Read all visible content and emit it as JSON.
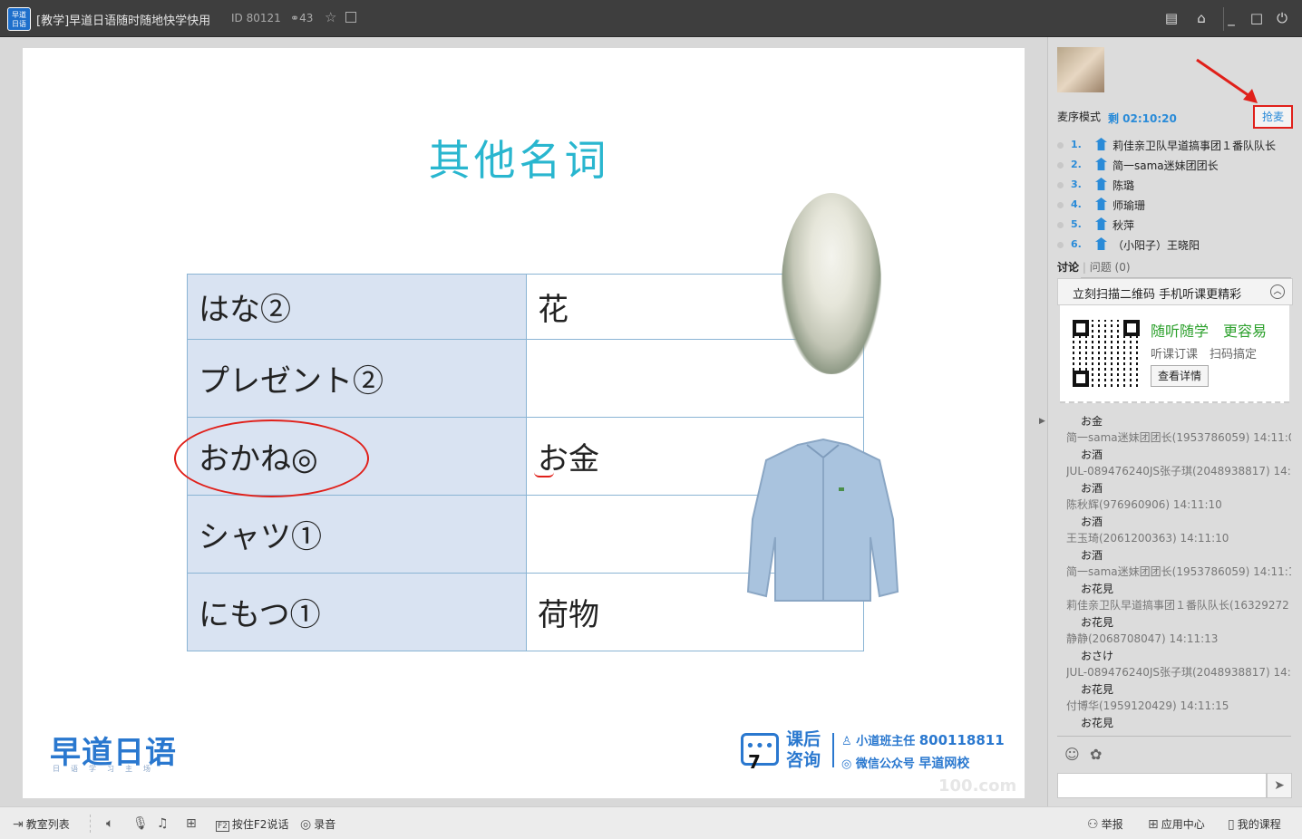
{
  "window": {
    "title": "[教学]早道日语随时随地快学快用",
    "room_id": "ID 80121",
    "user_count": "43",
    "logo_text": "早道日语"
  },
  "slide": {
    "title": "其他名词",
    "rows": [
      {
        "kana": "はな②",
        "kanji": "花"
      },
      {
        "kana": "プレゼント②",
        "kanji": ""
      },
      {
        "kana": "おかね◎",
        "kanji": "お金"
      },
      {
        "kana": "シャツ①",
        "kanji": ""
      },
      {
        "kana": "にもつ①",
        "kanji": "荷物"
      }
    ],
    "brand": "早道日语",
    "brand_sub": "日语学习主场",
    "consult": [
      "课后",
      "咨询"
    ],
    "contact1_label": "小道班主任",
    "contact1_value": "800118811",
    "contact2_label": "微信公众号",
    "contact2_value": "早道网校",
    "page_number": "7",
    "watermark": "100.com"
  },
  "panel": {
    "mode_label": "麦序模式",
    "time_left": "剩 02:10:20",
    "grab_mic": "抢麦",
    "queue": [
      {
        "num": "1.",
        "name": "莉佳亲卫队早道搞事团１番队队长"
      },
      {
        "num": "2.",
        "name": "简一sama迷妹团团长"
      },
      {
        "num": "3.",
        "name": "陈璐"
      },
      {
        "num": "4.",
        "name": "师瑜珊"
      },
      {
        "num": "5.",
        "name": "秋萍"
      },
      {
        "num": "6.",
        "name": "（小阳子）王晓阳"
      }
    ],
    "tab_discussion": "讨论",
    "tab_questions": "问题 (0)",
    "promo_header": "立刻扫描二维码 手机听课更精彩",
    "promo_line1": "随听随学　更容易",
    "promo_line2": "听课订课　扫码搞定",
    "promo_button": "查看详情",
    "chat": [
      {
        "text": "お金",
        "meta": "简一sama迷妹团团长(1953786059) 14:11:0"
      },
      {
        "text": "お酒",
        "meta": "JUL-089476240JS张子琪(2048938817) 14:"
      },
      {
        "text": "お酒",
        "meta": "陈秋辉(976960906) 14:11:10"
      },
      {
        "text": "お酒",
        "meta": "王玉琦(2061200363) 14:11:10"
      },
      {
        "text": "お酒",
        "meta": "简一sama迷妹团团长(1953786059) 14:11:1"
      },
      {
        "text": "お花見",
        "meta": "莉佳亲卫队早道搞事团１番队队长(16329272"
      },
      {
        "text": "お花見",
        "meta": "静静(2068708047) 14:11:13"
      },
      {
        "text": "おさけ",
        "meta": "JUL-089476240JS张子琪(2048938817) 14:"
      },
      {
        "text": "お花見",
        "meta": "付博华(1959120429) 14:11:15"
      },
      {
        "text": "お花見",
        "meta": ""
      }
    ]
  },
  "bottombar": {
    "classroom_list": "教室列表",
    "push_to_talk": "按住F2说话",
    "record": "录音",
    "report": "举报",
    "app_center": "应用中心",
    "my_courses": "我的课程"
  },
  "colors": {
    "accent": "#2a8bd8",
    "title_cyan": "#29b6cf",
    "annotation_red": "#e0201a",
    "kana_cell": "#d9e3f2"
  }
}
